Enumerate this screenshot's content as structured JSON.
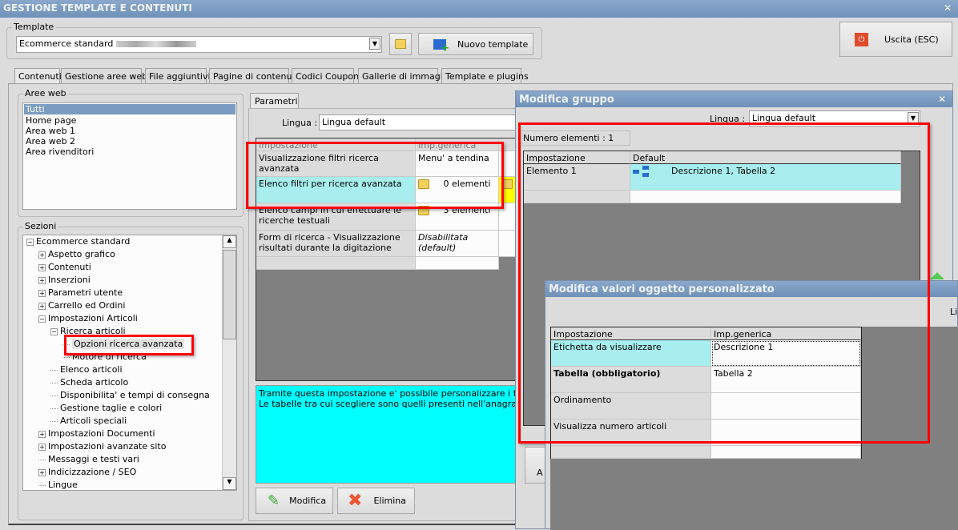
{
  "window": {
    "title": "GESTIONE TEMPLATE E CONTENUTI",
    "close": "✕"
  },
  "template": {
    "legend": "Template",
    "value": "Ecommerce standard",
    "new_button": "Nuovo template",
    "exit_button": "Uscita (ESC)"
  },
  "tabs": [
    "Contenuti",
    "Gestione aree web",
    "File aggiuntivi",
    "Pagine di contenuti",
    "Codici Coupon",
    "Gallerie di immagini",
    "Template e plugins"
  ],
  "aree_web": {
    "legend": "Aree web",
    "items": [
      "Tutti",
      "Home page",
      "Area web 1",
      "Area web 2",
      "Area rivenditori"
    ]
  },
  "sezioni": {
    "legend": "Sezioni",
    "items": [
      {
        "label": "Ecommerce standard",
        "level": 0,
        "exp": "−"
      },
      {
        "label": "Aspetto grafico",
        "level": 1,
        "exp": "+"
      },
      {
        "label": "Contenuti",
        "level": 1,
        "exp": "+"
      },
      {
        "label": "Inserzioni",
        "level": 1,
        "exp": "+"
      },
      {
        "label": "Parametri utente",
        "level": 1,
        "exp": "+"
      },
      {
        "label": "Carrello ed Ordini",
        "level": 1,
        "exp": "+"
      },
      {
        "label": "Impostazioni Articoli",
        "level": 1,
        "exp": "−"
      },
      {
        "label": "Ricerca articoli",
        "level": 2,
        "exp": "−"
      },
      {
        "label": "Opzioni ricerca avanzata",
        "level": 3,
        "exp": ""
      },
      {
        "label": "Motore di ricerca",
        "level": 3,
        "exp": ""
      },
      {
        "label": "Elenco articoli",
        "level": 2,
        "exp": ""
      },
      {
        "label": "Scheda articolo",
        "level": 2,
        "exp": ""
      },
      {
        "label": "Disponibilita' e tempi di consegna",
        "level": 2,
        "exp": ""
      },
      {
        "label": "Gestione taglie e colori",
        "level": 2,
        "exp": ""
      },
      {
        "label": "Articoli speciali",
        "level": 2,
        "exp": ""
      },
      {
        "label": "Impostazioni Documenti",
        "level": 1,
        "exp": "+"
      },
      {
        "label": "Impostazioni avanzate sito",
        "level": 1,
        "exp": "+"
      },
      {
        "label": "Messaggi e testi vari",
        "level": 1,
        "exp": ""
      },
      {
        "label": "Indicizzazione / SEO",
        "level": 1,
        "exp": "+"
      },
      {
        "label": "Lingue",
        "level": 1,
        "exp": ""
      }
    ]
  },
  "parametri": {
    "tab": "Parametri",
    "lingua_label": "Lingua :",
    "lingua_value": "Lingua default",
    "headers": [
      "Impostazione",
      "Imp.generica"
    ],
    "rows": [
      [
        "Visualizzazione filtri ricerca avanzata",
        "Menu' a tendina"
      ],
      [
        "Elenco filtri per ricerca avanzata",
        "0 elementi"
      ],
      [
        "Elenco campi in cui effettuare le ricerche testuali",
        "3 elementi"
      ],
      [
        "Form di ricerca - Visualizzazione risultati durante la digitazione",
        "Disabilitata (default)"
      ]
    ],
    "description": [
      "Tramite questa impostazione e' possibile personalizzare i filtri per il r",
      "Le tabelle tra cui scegliere sono quelli presenti nell'anagrafica dell'ar"
    ],
    "modifica": "Modifica",
    "elimina": "Elimina"
  },
  "gruppo": {
    "title": "Modifica gruppo",
    "lingua_label": "Lingua :",
    "lingua_value": "Lingua default",
    "count": "Numero elementi : 1",
    "headers": [
      "Impostazione",
      "Default"
    ],
    "rows": [
      [
        "Elemento 1",
        "Descrizione 1, Tabella 2"
      ]
    ],
    "partial_button": "A"
  },
  "oggetto": {
    "title": "Modifica valori oggetto personalizzato",
    "lingua_partial": "Lin",
    "headers": [
      "Impostazione",
      "Imp.generica"
    ],
    "rows": [
      [
        "Etichetta da visualizzare",
        "Descrizione 1"
      ],
      [
        "Tabella (obbligatorio)",
        "Tabella 2"
      ],
      [
        "Ordinamento",
        ""
      ],
      [
        "Visualizza numero articoli",
        ""
      ]
    ]
  }
}
